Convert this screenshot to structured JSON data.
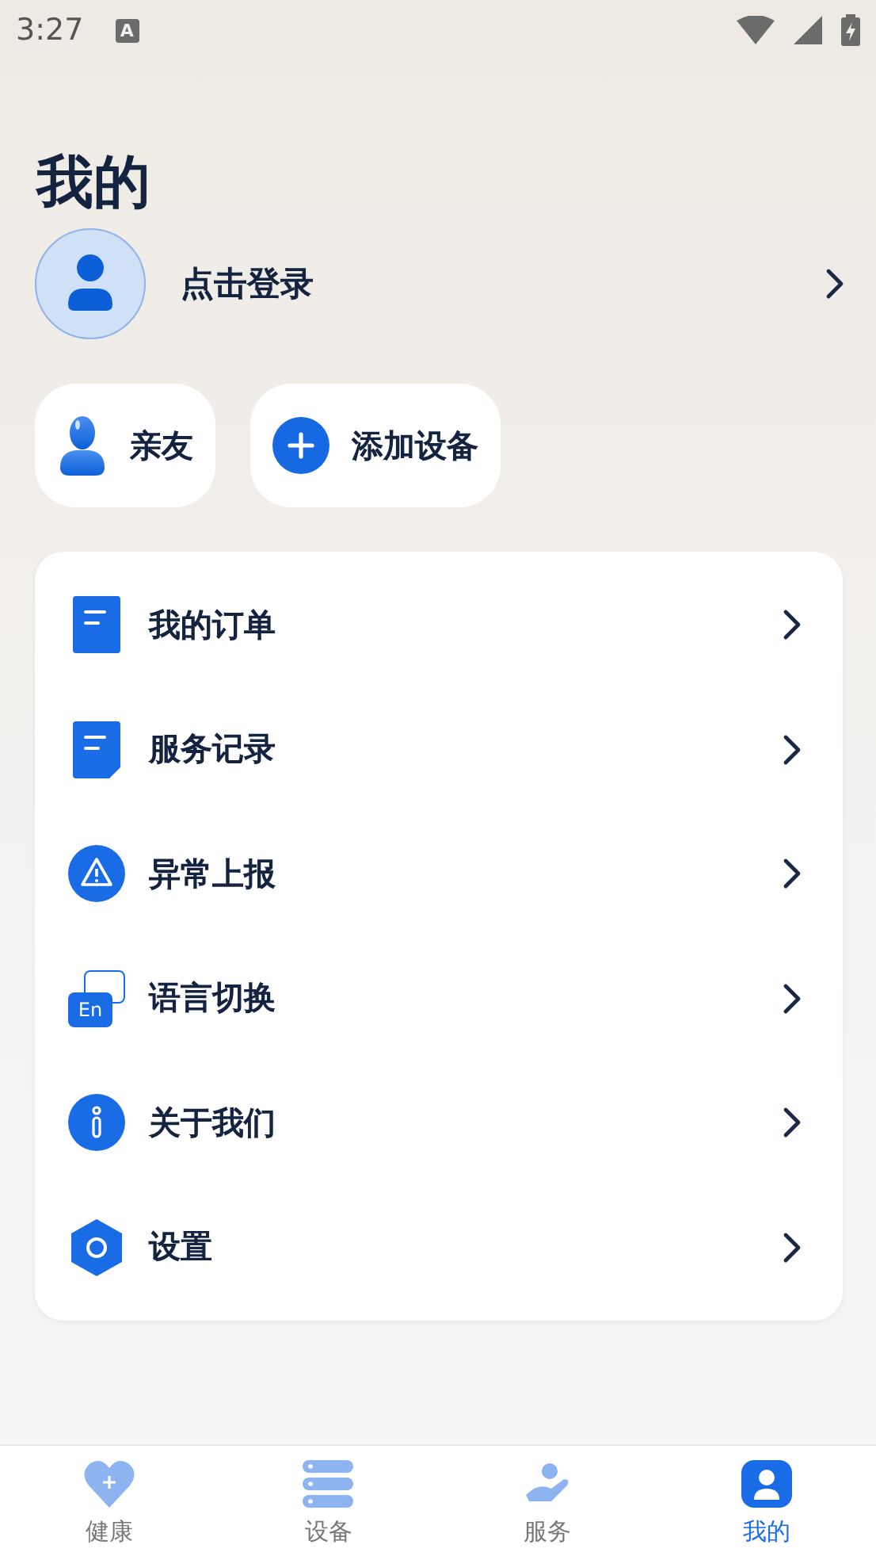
{
  "status_bar": {
    "time": "3:27",
    "notification": "A"
  },
  "title": "我的",
  "login": {
    "label": "点击登录"
  },
  "chips": [
    {
      "kind": "friends",
      "label": "亲友"
    },
    {
      "kind": "add",
      "label": "添加设备"
    }
  ],
  "menu": [
    {
      "kind": "order",
      "label": "我的订单"
    },
    {
      "kind": "record",
      "label": "服务记录"
    },
    {
      "kind": "warning",
      "label": "异常上报"
    },
    {
      "kind": "language",
      "label": "语言切换",
      "icon_label": "En"
    },
    {
      "kind": "info",
      "label": "关于我们"
    },
    {
      "kind": "settings",
      "label": "设置"
    }
  ],
  "tabs": [
    {
      "kind": "health",
      "label": "健康",
      "selected": false
    },
    {
      "kind": "devices",
      "label": "设备",
      "selected": false
    },
    {
      "kind": "service",
      "label": "服务",
      "selected": false
    },
    {
      "kind": "me",
      "label": "我的",
      "selected": true
    }
  ]
}
